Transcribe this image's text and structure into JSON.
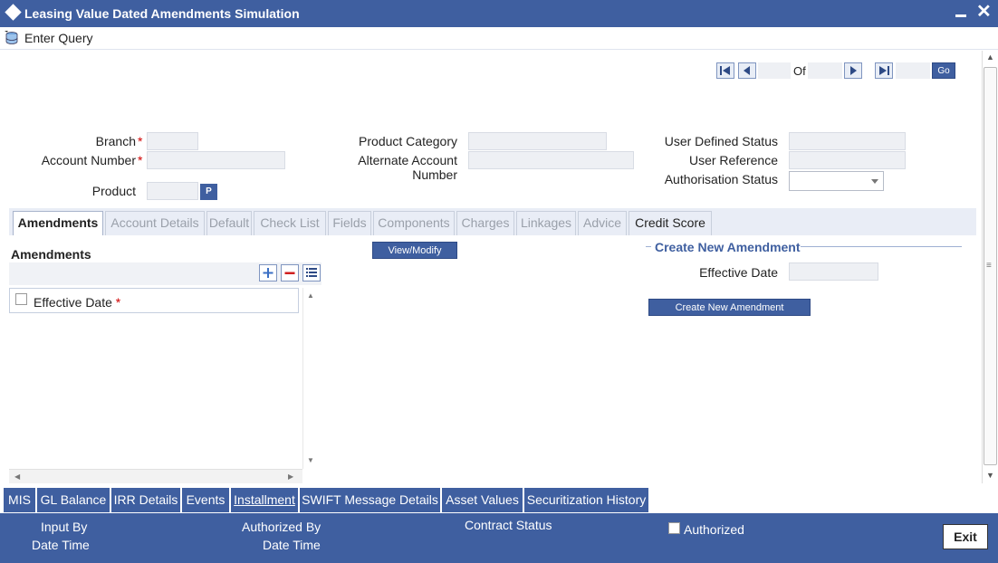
{
  "window": {
    "title": "Leasing Value Dated Amendments Simulation"
  },
  "toolbar": {
    "enter_query": "Enter Query"
  },
  "navigation": {
    "of_label": "Of",
    "go_label": "Go",
    "current_page": "",
    "total_pages": ""
  },
  "header_fields": {
    "branch_label": "Branch",
    "branch_value": "",
    "account_number_label": "Account Number",
    "account_number_value": "",
    "product_label": "Product",
    "product_value": "",
    "product_lov_label": "P",
    "product_category_label": "Product Category",
    "product_category_value": "",
    "alternate_account_label_line1": "Alternate Account",
    "alternate_account_label_line2": "Number",
    "alternate_account_value": "",
    "user_defined_status_label": "User Defined Status",
    "user_defined_status_value": "",
    "user_reference_label": "User Reference",
    "user_reference_value": "",
    "authorisation_status_label": "Authorisation Status",
    "authorisation_status_value": "",
    "required_marker": "*"
  },
  "tabs": [
    {
      "label": "Amendments",
      "state": "active"
    },
    {
      "label": "Account Details",
      "state": "disabled"
    },
    {
      "label": "Default",
      "state": "disabled"
    },
    {
      "label": "Check List",
      "state": "disabled"
    },
    {
      "label": "Fields",
      "state": "disabled"
    },
    {
      "label": "Components",
      "state": "disabled"
    },
    {
      "label": "Charges",
      "state": "disabled"
    },
    {
      "label": "Linkages",
      "state": "disabled"
    },
    {
      "label": "Advice",
      "state": "disabled"
    },
    {
      "label": "Credit Score",
      "state": "enabled"
    }
  ],
  "amendments": {
    "heading": "Amendments",
    "grid_header": "Effective Date",
    "view_modify_label": "View/Modify"
  },
  "create_new_amendment": {
    "legend": "Create New Amendment",
    "effective_date_label": "Effective Date",
    "effective_date_value": "",
    "button_label": "Create New Amendment"
  },
  "bottom_tabs": [
    {
      "label": "MIS"
    },
    {
      "label": "GL Balance"
    },
    {
      "label": "IRR Details"
    },
    {
      "label": "Events"
    },
    {
      "label": "Installment"
    },
    {
      "label": "SWIFT Message Details"
    },
    {
      "label": "Asset Values"
    },
    {
      "label": "Securitization History"
    }
  ],
  "footer": {
    "input_by": "Input By",
    "date_time_1": "Date Time",
    "authorized_by": "Authorized By",
    "date_time_2": "Date Time",
    "contract_status": "Contract Status",
    "authorized": "Authorized",
    "exit": "Exit"
  },
  "colors": {
    "brand": "#3f5fa0",
    "required": "#d00000",
    "field_bg": "#eef0f4"
  }
}
